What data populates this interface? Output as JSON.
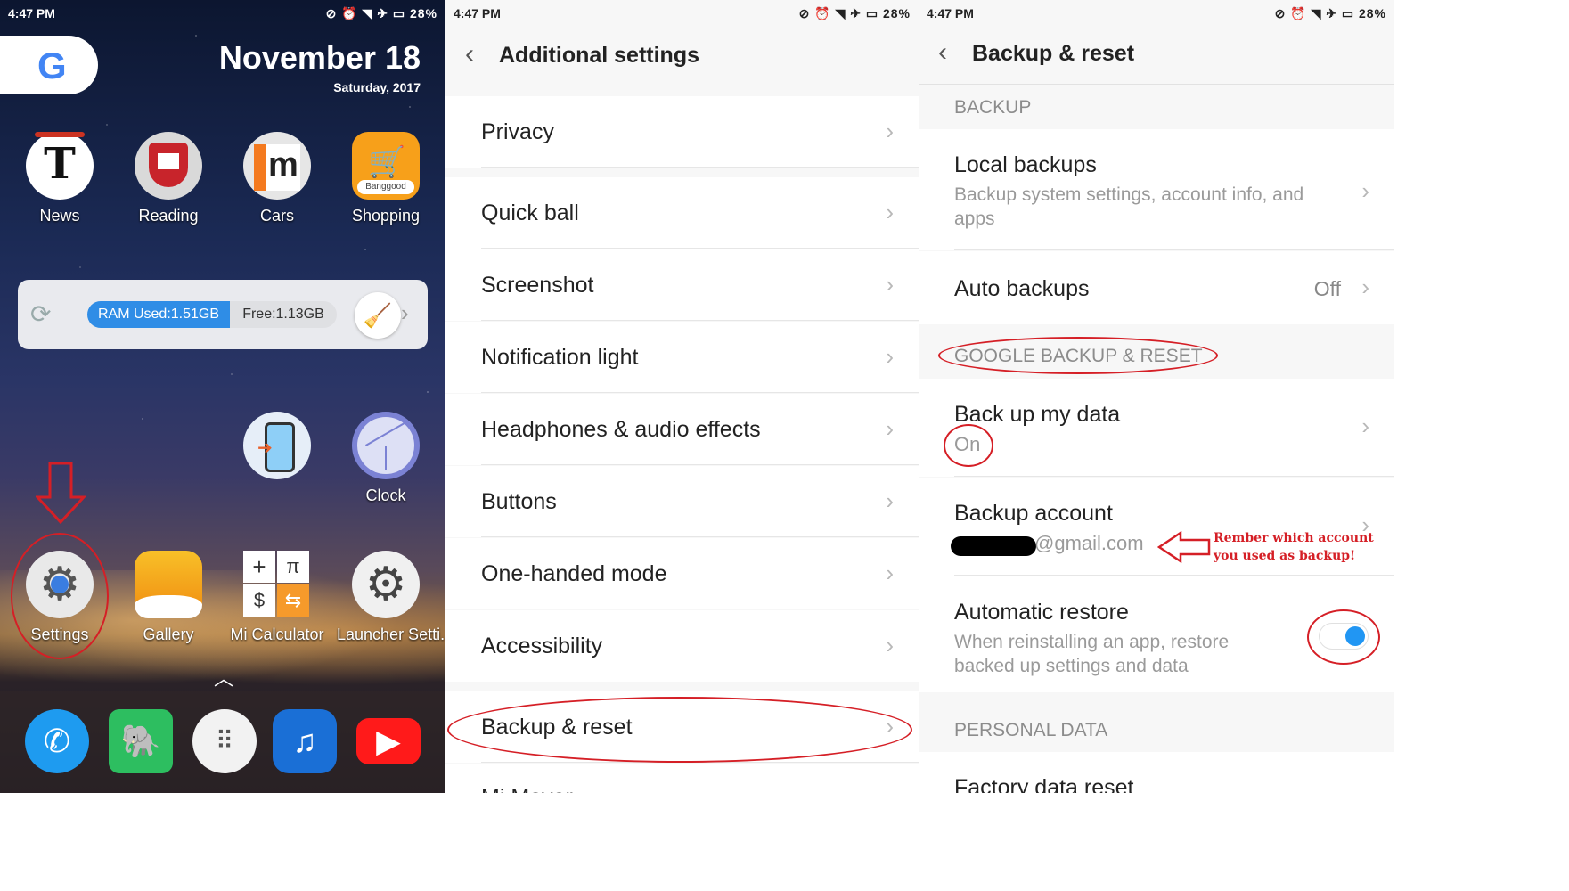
{
  "status_bar": {
    "time": "4:47 PM",
    "battery": "28%"
  },
  "home": {
    "date": "November 18",
    "day": "Saturday, 2017",
    "apps_row1": [
      {
        "label": "News"
      },
      {
        "label": "Reading"
      },
      {
        "label": "Cars"
      },
      {
        "label": "Shopping"
      }
    ],
    "ram": {
      "used": "RAM Used:1.51GB",
      "free": "Free:1.13GB"
    },
    "apps_row2": [
      {
        "label": "Clock"
      }
    ],
    "apps_row3": [
      {
        "label": "Settings"
      },
      {
        "label": "Gallery"
      },
      {
        "label": "Mi Calculator"
      },
      {
        "label": "Launcher Setti..."
      }
    ],
    "shopping_badge": "Banggood",
    "cars_letter": "m"
  },
  "additional_settings": {
    "title": "Additional settings",
    "items": [
      "Privacy",
      "Quick ball",
      "Screenshot",
      "Notification light",
      "Headphones & audio effects",
      "Buttons",
      "One-handed mode",
      "Accessibility",
      "Backup & reset",
      "Mi Mover"
    ]
  },
  "backup_reset": {
    "title": "Backup & reset",
    "section_backup": "BACKUP",
    "local_backups": {
      "title": "Local backups",
      "subtitle": "Backup system settings, account info, and apps"
    },
    "auto_backups": {
      "title": "Auto backups",
      "value": "Off"
    },
    "section_google": "GOOGLE BACKUP & RESET",
    "backup_my_data": {
      "title": "Back up my data",
      "value": "On"
    },
    "backup_account": {
      "title": "Backup account",
      "value": "@gmail.com"
    },
    "automatic_restore": {
      "title": "Automatic restore",
      "subtitle": "When reinstalling an app, restore backed up settings and data",
      "enabled": true
    },
    "section_personal": "PERSONAL DATA",
    "factory_reset": "Factory data reset",
    "annotation": "Rember which account you used as backup!"
  },
  "colors": {
    "accent": "#2196f3",
    "annotation": "#d51f26"
  }
}
